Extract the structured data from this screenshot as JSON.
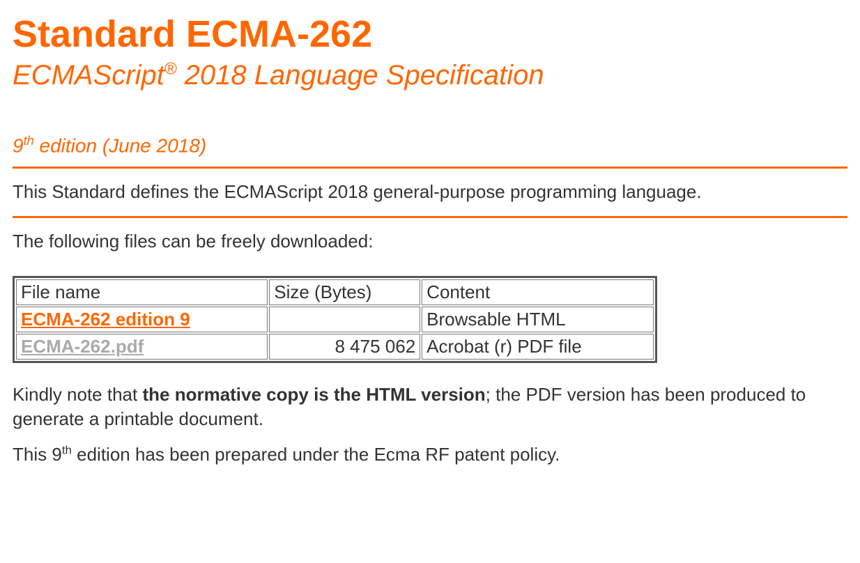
{
  "heading": {
    "title": "Standard ECMA-262",
    "subtitle_pre": "ECMAScript",
    "subtitle_sup": "®",
    "subtitle_post": " 2018 Language Specification",
    "edition_num": "9",
    "edition_sup": "th",
    "edition_rest": " edition (June 2018)"
  },
  "intro": "This Standard defines the ECMAScript 2018 general-purpose programming language.",
  "download_intro": "The following files can be freely downloaded:",
  "table": {
    "headers": [
      "File name",
      "Size (Bytes)",
      "Content"
    ],
    "rows": [
      {
        "filename": "ECMA-262 edition 9",
        "size": "",
        "content": "Browsable HTML",
        "link_style": "orange"
      },
      {
        "filename": "ECMA-262.pdf",
        "size": "8 475 062",
        "content": "Acrobat (r) PDF file",
        "link_style": "gray"
      }
    ]
  },
  "note": {
    "pre": "Kindly note that ",
    "bold": "the normative copy is the HTML version",
    "post": "; the PDF version has been produced to generate a printable document."
  },
  "policy": {
    "pre": "This 9",
    "sup": "th",
    "post": " edition has been prepared under the Ecma RF patent policy."
  }
}
